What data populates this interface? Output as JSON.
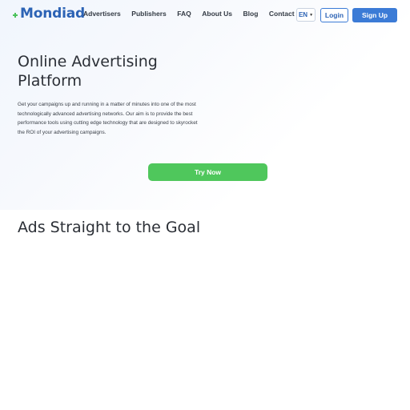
{
  "brand": {
    "logo_text": "Mondiad",
    "accent": "#3b7bd6",
    "logo_mark_color": "#4cc35c"
  },
  "nav": {
    "items": [
      {
        "label": "Advertisers"
      },
      {
        "label": "Publishers"
      },
      {
        "label": "FAQ"
      },
      {
        "label": "About Us"
      },
      {
        "label": "Blog"
      },
      {
        "label": "Contact"
      }
    ]
  },
  "header_actions": {
    "language": "EN",
    "login_label": "Login",
    "signup_label": "Sign Up"
  },
  "hero": {
    "title": "Online Advertising Platform",
    "description": "Get your campaigns up and running in a matter of minutes into one of the most technologically advanced advertising networks. Our aim is to provide the best performance tools using cutting edge technology that are designed to skyrocket the ROI of your advertising campaigns.",
    "cta_label": "Try Now",
    "cta_color": "#4fc75c"
  },
  "section": {
    "title": "Ads Straight to the Goal"
  }
}
